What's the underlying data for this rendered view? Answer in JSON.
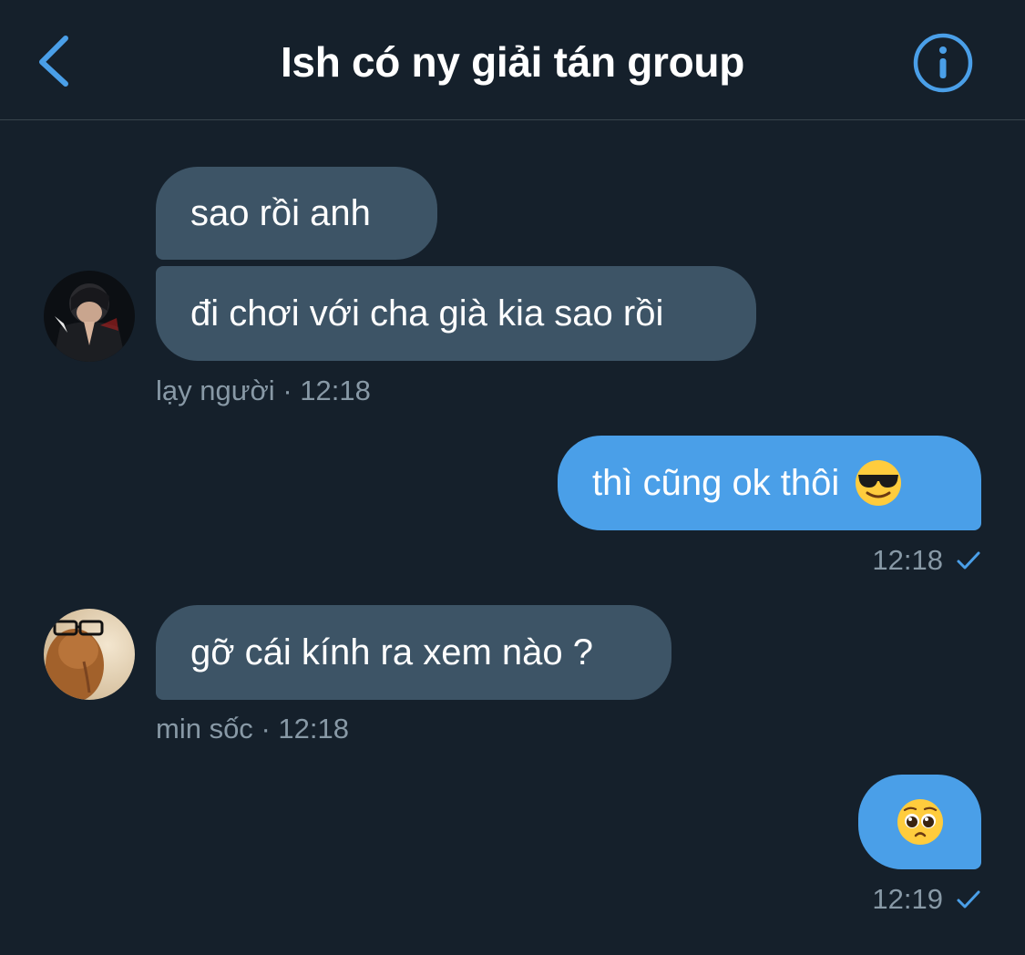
{
  "header": {
    "title": "Ish có ny giải tán group",
    "back_icon": "chevron-left-icon",
    "info_icon": "info-icon",
    "accent_color": "#4a9fe8"
  },
  "messages": [
    {
      "direction": "incoming",
      "text": "sao rồi anh"
    },
    {
      "direction": "incoming",
      "text": "đi chơi với cha già kia sao rồi",
      "sender": "lạy người",
      "time": "12:18"
    },
    {
      "direction": "outgoing",
      "text": "thì cũng ok thôi",
      "emoji": "smiling-face-with-sunglasses",
      "time": "12:18",
      "status": "sent"
    },
    {
      "direction": "incoming",
      "text": "gỡ cái kính ra xem nào ?",
      "sender": "min sốc",
      "time": "12:18"
    },
    {
      "direction": "outgoing",
      "text": "",
      "emoji": "pleading-face",
      "time": "12:19",
      "status": "sent"
    }
  ],
  "meta_separator": "·",
  "colors": {
    "background": "#15202b",
    "incoming_bubble": "#3d5466",
    "outgoing_bubble": "#4a9fe8",
    "meta_text": "#8899a6"
  }
}
